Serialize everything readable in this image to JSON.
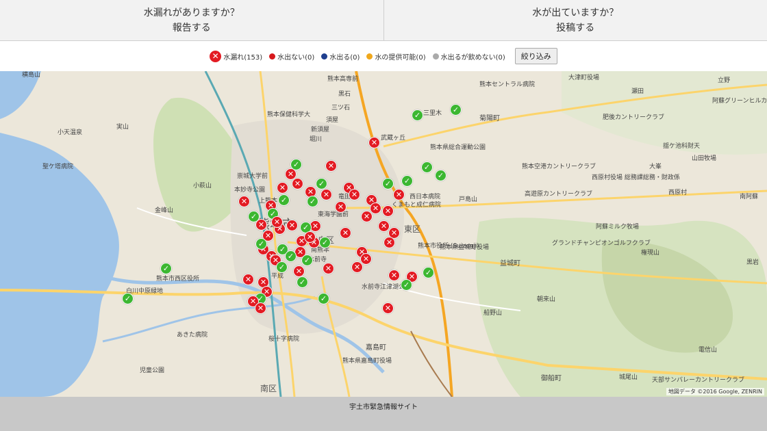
{
  "top_buttons": {
    "report": {
      "line1": "水漏れがありますか？",
      "line2": "報告する"
    },
    "post": {
      "line1": "水が出ていますか？",
      "line2": "投稿する"
    }
  },
  "legend": {
    "leak": "水漏れ(153)",
    "no_water": "水出ない(0)",
    "water_ok": "水出る(0)",
    "supply": "水の提供可能(0)",
    "not_drinkable": "水出るが飲めない(0)",
    "filter_button": "絞り込み",
    "colors": {
      "leak": "#e31b23",
      "no_water": "#d7191c",
      "water_ok": "#1f3f8f",
      "supply": "#f0a81c",
      "not_drinkable": "#aaaaaa"
    }
  },
  "map": {
    "labels": [
      "熊本市",
      "中央区",
      "東区",
      "南区",
      "嘉島町",
      "益城町",
      "菊陽町",
      "御船町",
      "小天温泉",
      "金峰山",
      "小萩山",
      "実山",
      "熊本県益城町役場",
      "熊本市西区役所",
      "白川中原緑地",
      "熊本高専前",
      "三ツ石",
      "熊本保健科学大",
      "黒石",
      "須屋",
      "堀川",
      "新須屋",
      "武蔵ヶ丘",
      "崇城大学前",
      "本妙寺公園",
      "竜田口",
      "東海学園前",
      "熊本県総合運動公園",
      "三里木",
      "上熊本",
      "南熊本",
      "水前寺",
      "水前寺江津湖公園",
      "平成",
      "桜十字病院",
      "熊本県嘉島町役場",
      "熊本空港カントリークラブ",
      "高遊原カントリークラブ",
      "西原村役場 総務課総務・財政係",
      "西原村",
      "大峯",
      "山田牧場",
      "阿蘇ミルク牧場",
      "グランドチャンピオンゴルフクラブ",
      "戸島山",
      "権現山",
      "朝来山",
      "船野山",
      "城尾山",
      "天部サンバレーカントリークラブ",
      "熊本セントラル病院",
      "大津町役場",
      "瀬田",
      "立野",
      "阿蘇グリーンヒルカントリークラブ",
      "肥後カントリークラブ",
      "揺ケ池科財天",
      "熊本市役所 (Suizenji)",
      "西日本病院",
      "くまもと成仁病院",
      "聖ケ塔病院",
      "あきた病院",
      "児童公園",
      "電信山",
      "黒岩",
      "南阿蘇",
      "横島山"
    ],
    "credit": "地図データ ©2016 Google, ZENRIN"
  },
  "footer": {
    "text": "宇土市緊急情報サイト"
  },
  "icons": {
    "red_marker": "x-mark-icon",
    "green_marker": "check-mark-icon"
  }
}
